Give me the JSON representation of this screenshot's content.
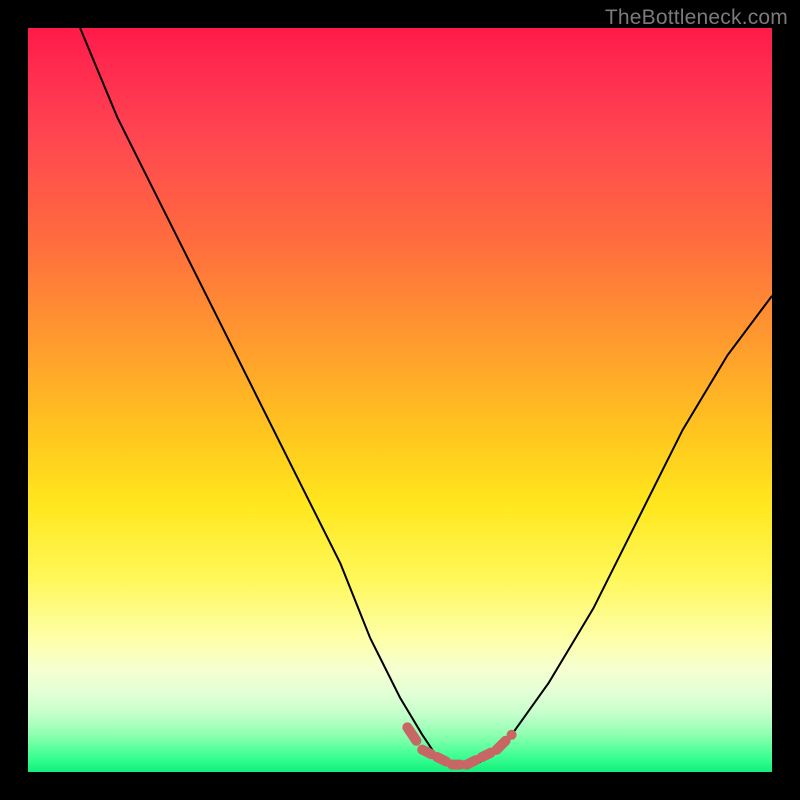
{
  "watermark": "TheBottleneck.com",
  "chart_data": {
    "type": "line",
    "title": "",
    "xlabel": "",
    "ylabel": "",
    "xlim": [
      0,
      100
    ],
    "ylim": [
      0,
      100
    ],
    "grid": false,
    "legend": false,
    "series": [
      {
        "name": "curve",
        "x": [
          7,
          12,
          18,
          24,
          30,
          36,
          42,
          46,
          50,
          53,
          55,
          57,
          60,
          62,
          65,
          70,
          76,
          82,
          88,
          94,
          100
        ],
        "values": [
          100,
          88,
          76,
          64,
          52,
          40,
          28,
          18,
          10,
          5,
          2,
          1,
          1,
          2,
          5,
          12,
          22,
          34,
          46,
          56,
          64
        ]
      }
    ],
    "highlight": {
      "name": "flat-region-dashes",
      "x": [
        51,
        53,
        55,
        57,
        59,
        61,
        63,
        65
      ],
      "values": [
        6,
        3,
        2,
        1,
        1,
        2,
        3,
        5
      ]
    },
    "background_gradient": {
      "top_color": "#ff1a4a",
      "mid_color": "#ffe71d",
      "bottom_color": "#12f07d"
    }
  }
}
